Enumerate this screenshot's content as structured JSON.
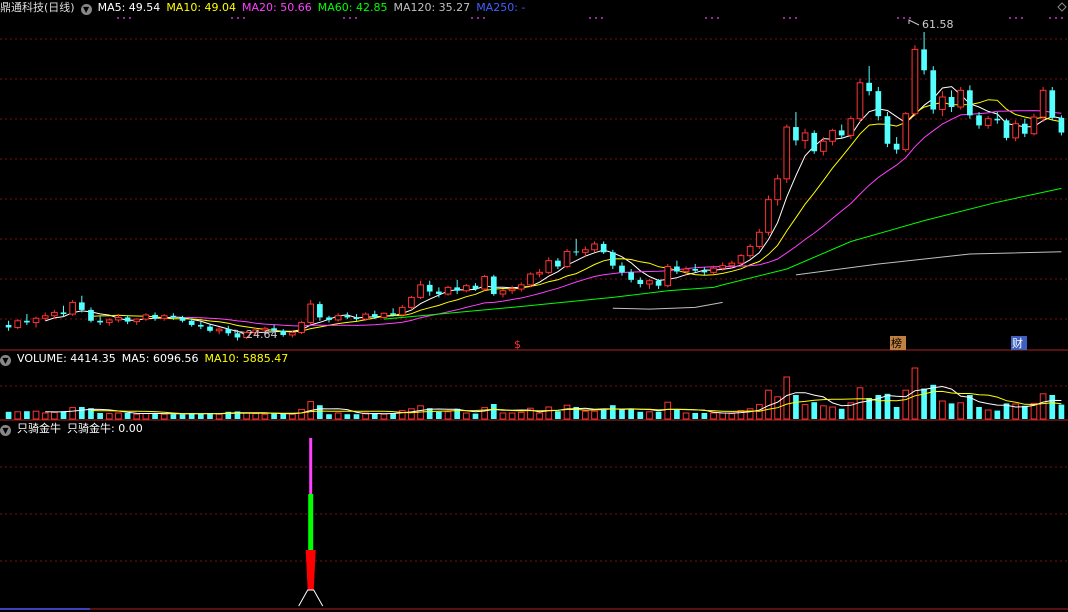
{
  "header": {
    "stock_name": "鼎通科技(日线)",
    "ma5": "MA5: 49.54",
    "ma10": "MA10: 49.04",
    "ma20": "MA20: 50.66",
    "ma60": "MA60: 42.85",
    "ma120": "MA120: 35.27",
    "ma250": "MA250: -",
    "colors": {
      "ma5": "#ffffff",
      "ma10": "#ffff00",
      "ma20": "#ff40ff",
      "ma60": "#00ff00",
      "ma120": "#c0c0c0",
      "ma250": "#4060ff"
    }
  },
  "volume_header": {
    "volume": "VOLUME: 4414.35",
    "ma5": "MA5: 6096.56",
    "ma10": "MA10: 5885.47"
  },
  "indicator_header": {
    "name": "只骑金牛",
    "value": "只骑金牛: 0.00"
  },
  "annotations": {
    "high": "61.58",
    "low": "24.64",
    "marker_s": "$",
    "marker_bang": "榜",
    "marker_cai": "财"
  },
  "chart_data": [
    {
      "type": "candlestick",
      "series": [
        {
          "name": "K线",
          "values": [
            [
              26.5,
              27.0,
              25.8,
              26.2
            ],
            [
              26.2,
              27.2,
              26.0,
              27.0
            ],
            [
              27.0,
              27.8,
              26.5,
              26.8
            ],
            [
              26.8,
              27.5,
              26.2,
              27.3
            ],
            [
              27.3,
              28.0,
              27.0,
              27.6
            ],
            [
              27.6,
              28.3,
              27.2,
              28.0
            ],
            [
              28.0,
              28.8,
              27.5,
              27.8
            ],
            [
              27.8,
              29.5,
              27.6,
              29.2
            ],
            [
              29.2,
              30.0,
              28.0,
              28.3
            ],
            [
              28.3,
              28.6,
              26.8,
              27.0
            ],
            [
              27.0,
              27.5,
              26.5,
              26.8
            ],
            [
              26.8,
              27.3,
              26.4,
              27.1
            ],
            [
              27.1,
              27.8,
              26.8,
              27.4
            ],
            [
              27.4,
              27.6,
              26.6,
              26.9
            ],
            [
              26.9,
              27.3,
              26.5,
              27.2
            ],
            [
              27.2,
              27.9,
              27.0,
              27.7
            ],
            [
              27.7,
              28.0,
              27.0,
              27.3
            ],
            [
              27.3,
              27.8,
              27.0,
              27.6
            ],
            [
              27.6,
              27.9,
              27.1,
              27.4
            ],
            [
              27.4,
              27.6,
              26.8,
              27.0
            ],
            [
              27.0,
              27.3,
              26.3,
              26.5
            ],
            [
              26.5,
              26.9,
              26.0,
              26.3
            ],
            [
              26.3,
              26.6,
              25.6,
              25.8
            ],
            [
              25.8,
              26.2,
              25.4,
              26.0
            ],
            [
              26.0,
              26.4,
              25.2,
              25.5
            ],
            [
              25.5,
              25.9,
              24.64,
              25.0
            ],
            [
              25.0,
              25.8,
              24.8,
              25.6
            ],
            [
              25.6,
              26.2,
              25.3,
              25.9
            ],
            [
              25.9,
              26.3,
              25.5,
              26.1
            ],
            [
              26.1,
              26.5,
              25.6,
              25.8
            ],
            [
              25.8,
              26.0,
              25.1,
              25.3
            ],
            [
              25.3,
              25.8,
              25.0,
              25.6
            ],
            [
              25.6,
              27.0,
              25.4,
              26.8
            ],
            [
              26.8,
              29.5,
              26.6,
              29.0
            ],
            [
              29.0,
              29.3,
              27.0,
              27.4
            ],
            [
              27.4,
              27.6,
              26.8,
              27.1
            ],
            [
              27.1,
              27.9,
              26.9,
              27.6
            ],
            [
              27.6,
              28.0,
              27.2,
              27.4
            ],
            [
              27.4,
              27.8,
              27.0,
              27.2
            ],
            [
              27.2,
              28.0,
              27.0,
              27.8
            ],
            [
              27.8,
              28.2,
              27.2,
              27.4
            ],
            [
              27.4,
              28.0,
              27.2,
              27.9
            ],
            [
              27.9,
              28.5,
              27.5,
              27.7
            ],
            [
              27.7,
              28.9,
              27.5,
              28.6
            ],
            [
              28.6,
              30.0,
              28.3,
              29.8
            ],
            [
              29.8,
              31.8,
              29.6,
              31.3
            ],
            [
              31.3,
              31.8,
              30.0,
              30.5
            ],
            [
              30.5,
              31.0,
              29.8,
              30.2
            ],
            [
              30.2,
              31.2,
              30.0,
              31.0
            ],
            [
              31.0,
              31.9,
              30.2,
              30.6
            ],
            [
              30.6,
              31.4,
              30.4,
              31.2
            ],
            [
              31.2,
              31.5,
              30.6,
              30.8
            ],
            [
              30.8,
              32.5,
              30.6,
              32.3
            ],
            [
              32.3,
              32.5,
              30.0,
              30.2
            ],
            [
              30.2,
              30.8,
              29.8,
              30.6
            ],
            [
              30.6,
              31.2,
              30.2,
              30.8
            ],
            [
              30.8,
              31.6,
              30.5,
              31.3
            ],
            [
              31.3,
              32.8,
              31.0,
              32.6
            ],
            [
              32.6,
              33.2,
              32.2,
              32.8
            ],
            [
              32.8,
              34.6,
              32.6,
              34.2
            ],
            [
              34.2,
              34.5,
              33.2,
              33.5
            ],
            [
              33.5,
              35.6,
              33.3,
              35.3
            ],
            [
              35.3,
              36.8,
              34.8,
              35.2
            ],
            [
              35.2,
              35.9,
              34.6,
              35.5
            ],
            [
              35.5,
              36.5,
              35.2,
              36.2
            ],
            [
              36.2,
              36.5,
              35.0,
              35.2
            ],
            [
              35.2,
              35.5,
              33.2,
              33.6
            ],
            [
              33.6,
              34.0,
              32.4,
              32.8
            ],
            [
              32.8,
              33.2,
              31.6,
              31.9
            ],
            [
              31.9,
              32.2,
              31.0,
              31.4
            ],
            [
              31.4,
              32.0,
              30.8,
              31.8
            ],
            [
              31.8,
              32.0,
              30.8,
              31.2
            ],
            [
              31.2,
              33.8,
              31.0,
              33.5
            ],
            [
              33.5,
              34.2,
              32.6,
              32.9
            ],
            [
              32.9,
              33.5,
              32.5,
              33.2
            ],
            [
              33.2,
              33.8,
              32.8,
              33.0
            ],
            [
              33.0,
              33.4,
              32.4,
              32.8
            ],
            [
              32.8,
              33.6,
              32.6,
              33.3
            ],
            [
              33.3,
              34.0,
              33.0,
              33.6
            ],
            [
              33.6,
              34.2,
              33.3,
              33.9
            ],
            [
              33.9,
              35.0,
              33.6,
              34.8
            ],
            [
              34.8,
              36.2,
              34.5,
              35.9
            ],
            [
              35.9,
              38.0,
              35.6,
              37.6
            ],
            [
              37.6,
              42.0,
              37.2,
              41.5
            ],
            [
              41.5,
              44.5,
              40.8,
              44.0
            ],
            [
              44.0,
              50.5,
              43.5,
              50.2
            ],
            [
              50.2,
              52.0,
              48.0,
              48.6
            ],
            [
              48.6,
              50.0,
              47.6,
              49.5
            ],
            [
              49.5,
              49.8,
              47.0,
              47.3
            ],
            [
              47.3,
              49.0,
              46.8,
              48.5
            ],
            [
              48.5,
              50.0,
              48.0,
              49.8
            ],
            [
              49.8,
              50.5,
              48.8,
              49.2
            ],
            [
              49.2,
              51.5,
              48.8,
              51.2
            ],
            [
              51.2,
              56.0,
              50.8,
              55.5
            ],
            [
              55.5,
              57.5,
              54.0,
              54.5
            ],
            [
              54.5,
              55.0,
              51.0,
              51.5
            ],
            [
              51.5,
              52.0,
              47.8,
              48.2
            ],
            [
              48.2,
              49.0,
              47.0,
              47.5
            ],
            [
              47.5,
              52.0,
              47.2,
              51.8
            ],
            [
              51.8,
              60.0,
              51.5,
              59.5
            ],
            [
              59.5,
              61.58,
              56.5,
              57.0
            ],
            [
              57.0,
              57.5,
              51.8,
              52.3
            ],
            [
              52.3,
              54.5,
              51.5,
              53.8
            ],
            [
              53.8,
              54.6,
              52.0,
              52.6
            ],
            [
              52.6,
              55.0,
              52.3,
              54.6
            ],
            [
              54.6,
              55.2,
              51.2,
              51.6
            ],
            [
              51.6,
              52.0,
              50.0,
              50.4
            ],
            [
              50.4,
              51.5,
              50.0,
              51.2
            ],
            [
              51.2,
              52.0,
              50.6,
              51.0
            ],
            [
              51.0,
              51.2,
              48.6,
              48.9
            ],
            [
              48.9,
              51.0,
              48.5,
              50.6
            ],
            [
              50.6,
              51.2,
              49.0,
              49.4
            ],
            [
              49.4,
              51.8,
              49.2,
              51.4
            ],
            [
              51.4,
              55.0,
              50.8,
              54.6
            ],
            [
              54.6,
              55.0,
              51.0,
              51.3
            ],
            [
              51.3,
              51.6,
              49.2,
              49.54
            ]
          ]
        }
      ],
      "ylim": [
        23.5,
        63.5
      ]
    },
    {
      "type": "bar",
      "series": [
        {
          "name": "VOLUME"
        }
      ]
    },
    {
      "type": "bar",
      "series": [
        {
          "name": "只骑金牛",
          "values": [
            0,
            0,
            0,
            0,
            0,
            0,
            0,
            0,
            0,
            0,
            0,
            0,
            0,
            0,
            0,
            0,
            0,
            0,
            0,
            0,
            0,
            0,
            0,
            0,
            0,
            0,
            0,
            0,
            0,
            0,
            0,
            0,
            0,
            1,
            0,
            0,
            0,
            0,
            0,
            0,
            0,
            0,
            0,
            0,
            0,
            0,
            0,
            0,
            0,
            0,
            0,
            0,
            0,
            0,
            0,
            0,
            0,
            0,
            0,
            0,
            0,
            0,
            0,
            0,
            0,
            0,
            0,
            0,
            0,
            0,
            0,
            0,
            0,
            0,
            0,
            0,
            0,
            0,
            0,
            0,
            0,
            0,
            0,
            0,
            0,
            0,
            0,
            0,
            0,
            0,
            0,
            0,
            0,
            0,
            0,
            0,
            0,
            0,
            0,
            0,
            0,
            0,
            0,
            0,
            0,
            0,
            0,
            0,
            0,
            0,
            0,
            0,
            0,
            0,
            0,
            0
          ]
        }
      ]
    }
  ]
}
